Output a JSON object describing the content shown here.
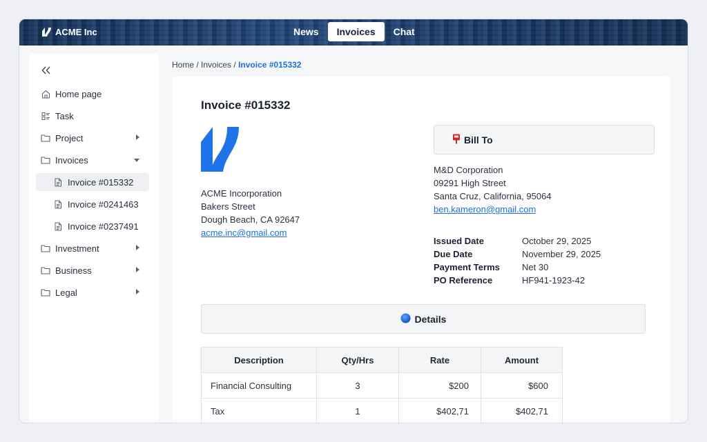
{
  "app": {
    "brand_name": "ACME Inc"
  },
  "topnav": {
    "tabs": [
      {
        "label": "News"
      },
      {
        "label": "Invoices",
        "active": true
      },
      {
        "label": "Chat"
      }
    ]
  },
  "sidebar": {
    "collapse_icon": "double-chevron-left-icon",
    "items": [
      {
        "label": "Home page",
        "icon": "home-icon"
      },
      {
        "label": "Task",
        "icon": "task-list-icon"
      },
      {
        "label": "Project",
        "icon": "folder-icon"
      },
      {
        "label": "Invoices",
        "icon": "folder-icon",
        "expanded": true
      },
      {
        "label": "Invoice #015332",
        "icon": "document-icon",
        "selected": true
      },
      {
        "label": "Invoice #0241463",
        "icon": "document-icon"
      },
      {
        "label": "Invoice #0237491",
        "icon": "document-icon"
      },
      {
        "label": "Investment",
        "icon": "folder-icon"
      },
      {
        "label": "Business",
        "icon": "folder-icon"
      },
      {
        "label": "Legal",
        "icon": "folder-icon"
      }
    ]
  },
  "breadcrumb": {
    "home": "Home",
    "sep": " / ",
    "invoices": "Invoices",
    "current": "Invoice #015332"
  },
  "invoice": {
    "title": "Invoice #015332",
    "from": {
      "name": "ACME Incorporation",
      "street": "Bakers Street",
      "city": "Dough Beach, CA 92647",
      "email": "acme.inc@gmail.com"
    },
    "bill_to_label": "Bill To",
    "bill_to_icon": "postbox-icon",
    "to": {
      "name": "M&D Corporation",
      "street": "09291 High Street",
      "city": "Santa Cruz, California, 95064",
      "email": "ben.kameron@gmail.com"
    },
    "meta": [
      {
        "label": "Issued Date",
        "value": "October 29, 2025"
      },
      {
        "label": "Due Date",
        "value": "November 29, 2025"
      },
      {
        "label": "Payment Terms",
        "value": "Net 30"
      },
      {
        "label": "PO Reference",
        "value": "HF941-1923-42"
      }
    ],
    "details_label": "Details",
    "details_icon": "blue-circle-icon",
    "table": {
      "headers": [
        "Description",
        "Qty/Hrs",
        "Rate",
        "Amount"
      ],
      "rows": [
        [
          "Financial Consulting",
          "3",
          "$200",
          "$600"
        ],
        [
          "Tax",
          "1",
          "$402,71",
          "$402,71"
        ]
      ]
    }
  },
  "colors": {
    "accent": "#1e6fd9",
    "brand_logo": "#1e73e8",
    "topbar": "#1b3a66"
  }
}
